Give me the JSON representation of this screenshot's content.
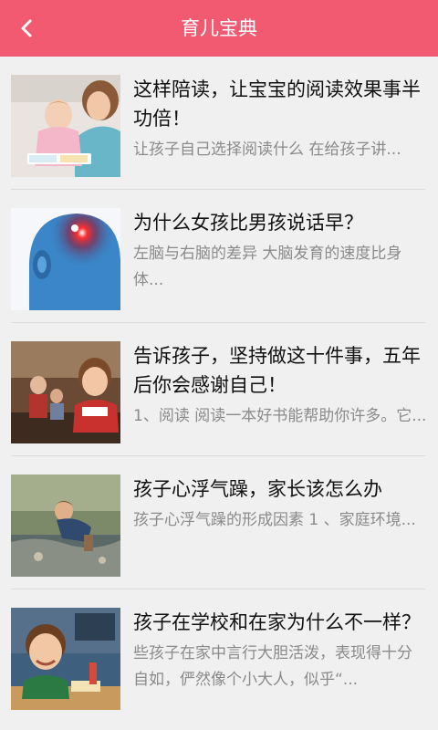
{
  "header": {
    "title": "育儿宝典",
    "back_icon": "chevron-left-icon",
    "color": "#f25a72"
  },
  "articles": [
    {
      "title": "这样陪读，让宝宝的阅读效果事半功倍！",
      "summary": "让孩子自己选择阅读什么 在给孩子讲...",
      "thumbnail": "mother-reading-with-baby-photo"
    },
    {
      "title": "为什么女孩比男孩说话早？",
      "summary": "左脑与右脑的差异 大脑发育的速度比身体...",
      "thumbnail": "brain-scan-head-photo"
    },
    {
      "title": "告诉孩子，坚持做这十件事，五年后你会感谢自己！",
      "summary": "1、阅读 阅读一本好书能帮助你许多。它...",
      "thumbnail": "children-in-classroom-photo"
    },
    {
      "title": "孩子心浮气躁，家长该怎么办",
      "summary": "孩子心浮气躁的形成因素 1 、家庭环境...",
      "thumbnail": "child-playing-by-water-photo"
    },
    {
      "title": "孩子在学校和在家为什么不一样？",
      "summary": "些孩子在家中言行大胆活泼，表现得十分自如，俨然像个小大人，似乎“...",
      "thumbnail": "smiling-boy-at-school-desk-photo"
    }
  ]
}
